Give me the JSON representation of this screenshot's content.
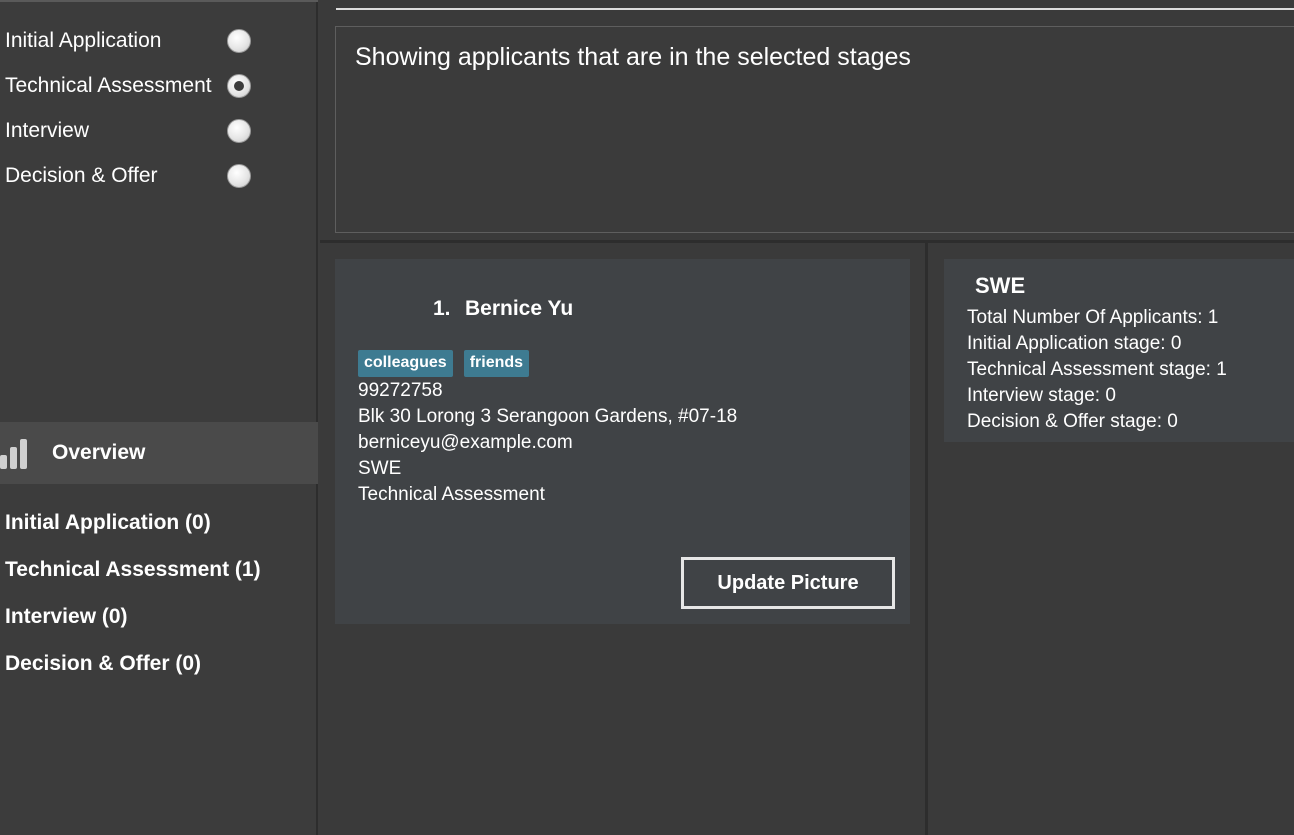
{
  "stage_filters": [
    {
      "label": "Initial Application",
      "selected": false
    },
    {
      "label": "Technical Assessment",
      "selected": true
    },
    {
      "label": "Interview",
      "selected": false
    },
    {
      "label": "Decision & Offer",
      "selected": false
    }
  ],
  "nav": {
    "overview_label": "Overview",
    "overview_icon": "bar-chart-icon",
    "stage_counts": [
      "Initial Application (0)",
      "Technical Assessment (1)",
      "Interview (0)",
      "Decision & Offer (0)"
    ]
  },
  "result": {
    "message": "Showing applicants that are in the selected stages"
  },
  "applicant": {
    "index": "1.",
    "name": "Bernice Yu",
    "tags": [
      "colleagues",
      "friends"
    ],
    "phone": "99272758",
    "address": "Blk 30 Lorong 3 Serangoon Gardens, #07-18",
    "email": "berniceyu@example.com",
    "role": "SWE",
    "stage": "Technical Assessment",
    "update_button": "Update Picture"
  },
  "stats": {
    "title": "SWE",
    "lines": [
      "Total Number Of Applicants: 1",
      "Initial Application stage: 0",
      "Technical Assessment stage: 1",
      "Interview stage: 0",
      "Decision & Offer stage: 0"
    ]
  },
  "colors": {
    "background": "#3b3b3b",
    "card": "#404346",
    "tag": "#3e7b91",
    "selected_nav": "#4a4a4a"
  }
}
